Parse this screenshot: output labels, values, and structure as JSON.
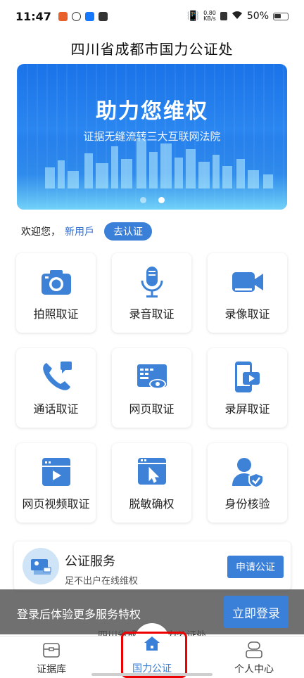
{
  "status_bar": {
    "time": "11:47",
    "speed_top": "0.80",
    "speed_bottom": "KB/s",
    "battery": "50%"
  },
  "header": {
    "title": "四川省成都市国力公证处"
  },
  "banner": {
    "title": "助力您维权",
    "subtitle": "证据无缝流转三大互联网法院",
    "page_count": 2,
    "active_page": 2
  },
  "welcome": {
    "greeting": "欢迎您，",
    "user": "新用戶",
    "auth_button": "去认证"
  },
  "features": [
    {
      "label": "拍照取证",
      "icon": "camera-icon"
    },
    {
      "label": "录音取证",
      "icon": "microphone-icon"
    },
    {
      "label": "录像取证",
      "icon": "video-camera-icon"
    },
    {
      "label": "通话取证",
      "icon": "phone-icon"
    },
    {
      "label": "网页取证",
      "icon": "web-eye-icon"
    },
    {
      "label": "录屏取证",
      "icon": "screen-record-icon"
    },
    {
      "label": "网页视频取证",
      "icon": "web-video-icon"
    },
    {
      "label": "脱敏确权",
      "icon": "desensitize-icon"
    },
    {
      "label": "身份核验",
      "icon": "identity-check-icon"
    }
  ],
  "service": {
    "title": "公证服务",
    "subtitle": "足不出户在线维权",
    "apply_button": "申请公证"
  },
  "login_bar": {
    "text": "登录后体验更多服务特权",
    "button": "立即登录"
  },
  "under_text": "四川省成都市国力公证处",
  "nav": [
    {
      "label": "证据库",
      "icon": "evidence-box-icon"
    },
    {
      "label": "国力公证",
      "icon": "home-icon"
    },
    {
      "label": "个人中心",
      "icon": "profile-icon"
    }
  ],
  "colors": {
    "accent": "#3a7fd8",
    "icon_blue": "#3d82d6",
    "banner_blue": "#1a73e8",
    "highlight": "#ee0000"
  }
}
